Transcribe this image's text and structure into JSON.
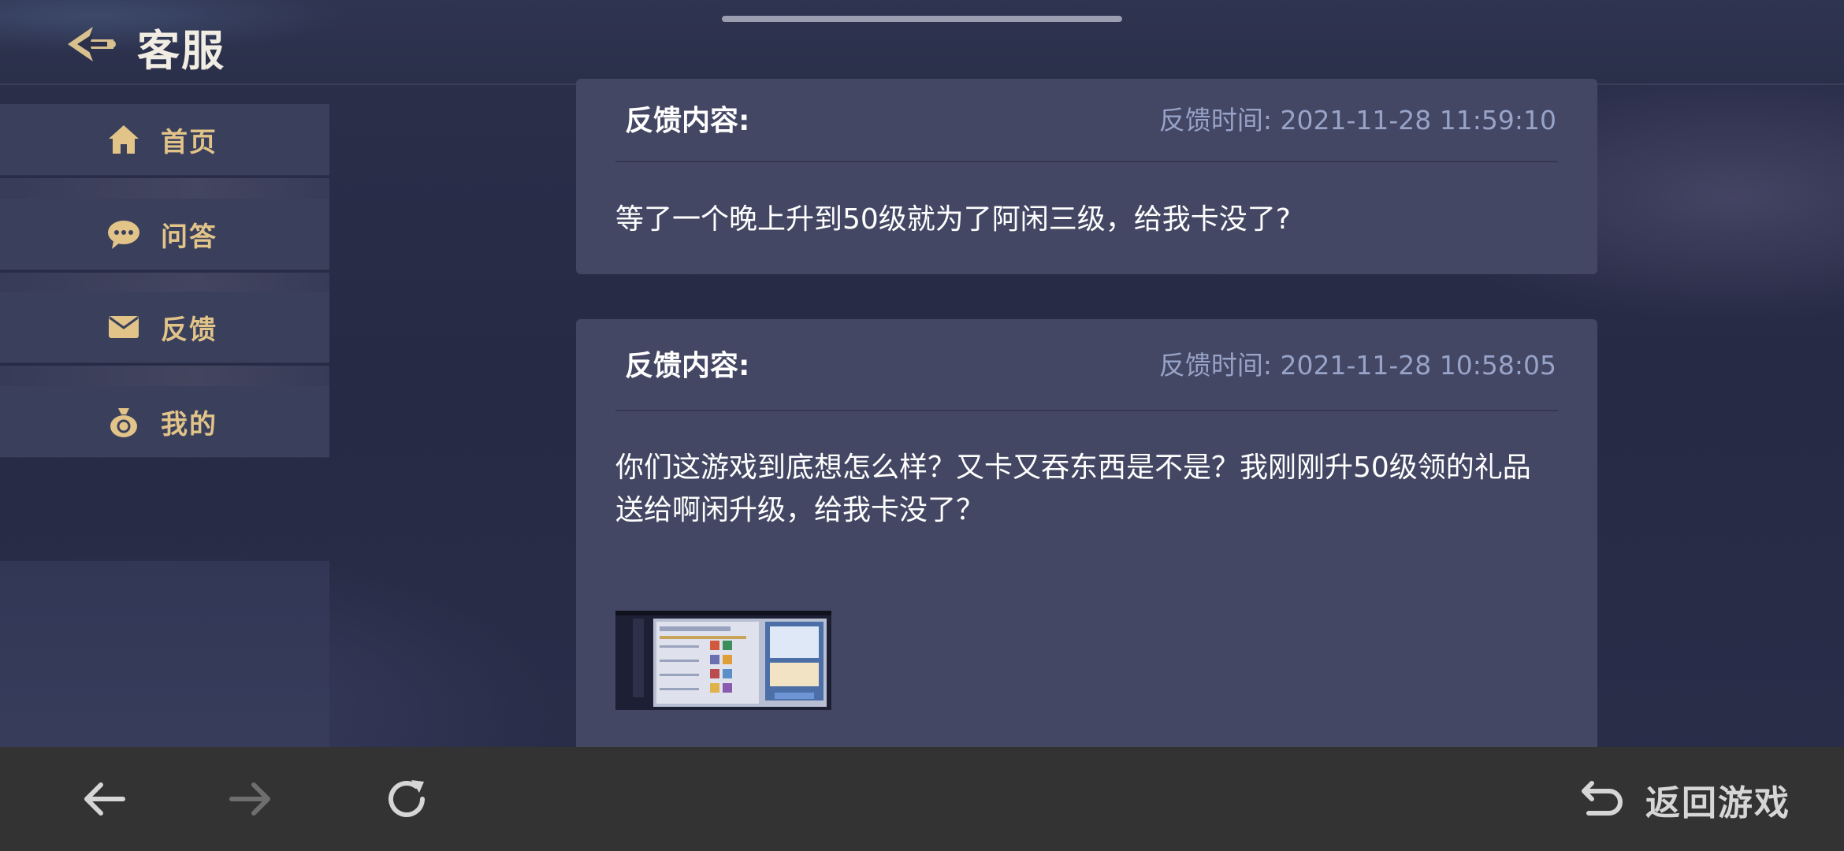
{
  "header": {
    "title": "客服"
  },
  "sidebar": {
    "items": [
      {
        "label": "首页",
        "icon": "home-icon"
      },
      {
        "label": "问答",
        "icon": "chat-bubble-icon"
      },
      {
        "label": "反馈",
        "icon": "envelope-icon"
      },
      {
        "label": "我的",
        "icon": "money-bag-icon"
      }
    ]
  },
  "feedback": [
    {
      "label": "反馈内容:",
      "time": "反馈时间: 2021-11-28 11:59:10",
      "text": "等了一个晚上升到50级就为了阿闲三级，给我卡没了?"
    },
    {
      "label": "反馈内容:",
      "time": "反馈时间: 2021-11-28 10:58:05",
      "text": "你们这游戏到底想怎么样？又卡又吞东西是不是？我刚刚升50级领的礼品送给啊闲升级，给我卡没了？",
      "has_image": true
    }
  ],
  "bottom": {
    "return_label": "返回游戏"
  },
  "colors": {
    "accent_gold": "#e2c489",
    "card_bg": "#444763",
    "time_text": "#97a3c8",
    "bottom_bar": "#333333"
  }
}
